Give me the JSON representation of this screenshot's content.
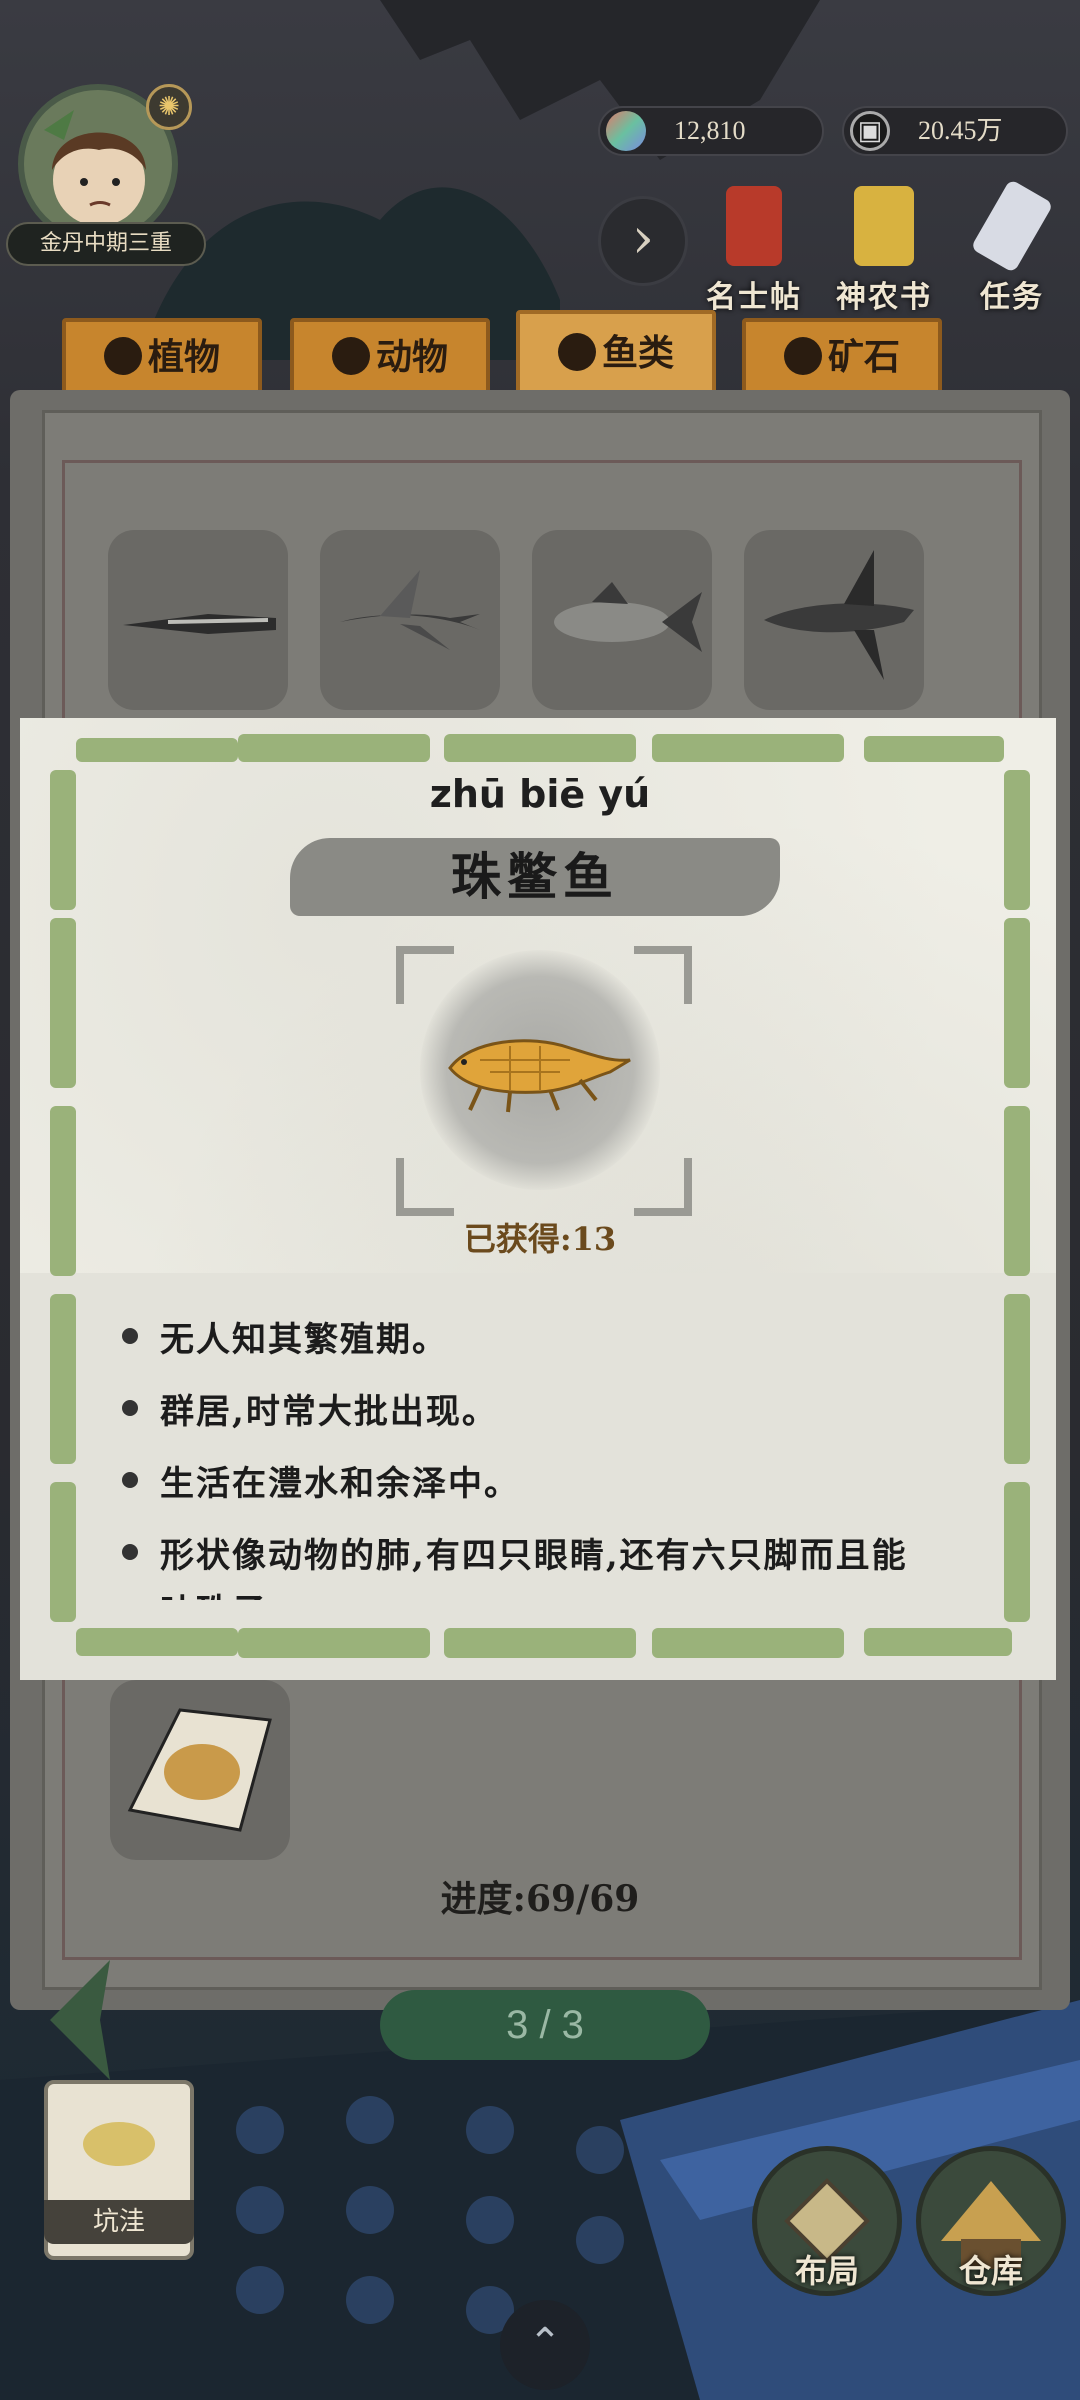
{
  "player": {
    "rank": "金丹中期三重",
    "avatar_icon": "player-avatar",
    "badge_icon": "sun-icon"
  },
  "resources": [
    {
      "name": "spirit-stone",
      "value": "12,810"
    },
    {
      "name": "copper-coin",
      "value": "20.45万"
    }
  ],
  "quick_menu": [
    {
      "id": "celebrity",
      "label": "名士帖"
    },
    {
      "id": "shennong",
      "label": "神农书"
    },
    {
      "id": "tasks",
      "label": "任务"
    }
  ],
  "tabs": [
    {
      "id": "plants",
      "label": "植物",
      "active": false
    },
    {
      "id": "animals",
      "label": "动物",
      "active": false
    },
    {
      "id": "fish",
      "label": "鱼类",
      "active": true
    },
    {
      "id": "minerals",
      "label": "矿石",
      "active": false
    }
  ],
  "book": {
    "progress": "进度:69/69",
    "pager": "3 / 3"
  },
  "detail": {
    "pinyin": "zhū biē yú",
    "name": "珠鳖鱼",
    "obtained": "已获得:13",
    "descriptions": [
      "无人知其繁殖期。",
      "群居,时常大批出现。",
      "生活在澧水和余泽中。",
      "形状像动物的肺,有四只眼睛,还有六只脚而且能吐珠子。"
    ]
  },
  "bottom": {
    "pit_label": "坑洼",
    "layout_label": "布局",
    "warehouse_label": "仓库"
  },
  "colors": {
    "tab": "#c7852d",
    "frame_green": "#9ab27a",
    "pager": "#2f5a41"
  }
}
